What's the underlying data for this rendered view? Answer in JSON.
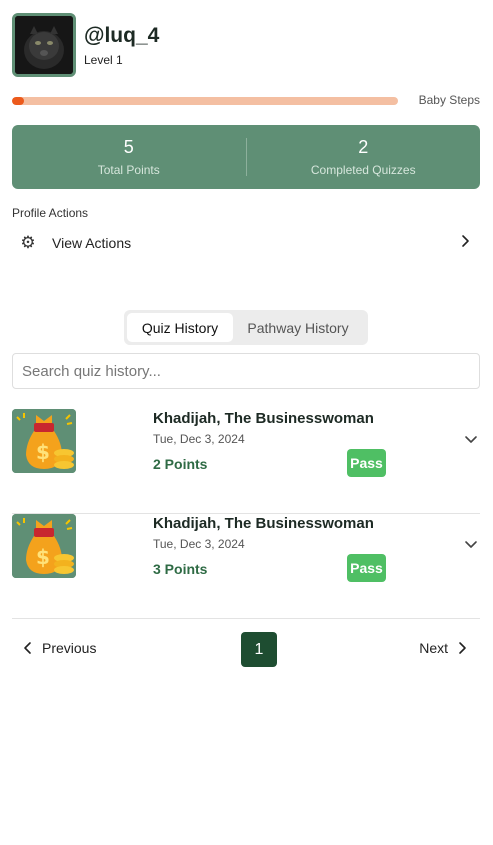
{
  "profile": {
    "username": "@luq_4",
    "level": "Level 1",
    "progress_fraction": 0.03,
    "progress_label": "Baby Steps"
  },
  "stats": [
    {
      "value": "5",
      "label": "Total Points"
    },
    {
      "value": "2",
      "label": "Completed Quizzes"
    }
  ],
  "profile_actions": {
    "title": "Profile Actions",
    "view_actions_label": "View Actions",
    "icon": "gear-icon"
  },
  "tabs": [
    {
      "label": "Quiz History",
      "active": true
    },
    {
      "label": "Pathway History",
      "active": false
    }
  ],
  "search": {
    "placeholder": "Search quiz history...",
    "value": ""
  },
  "quiz_history": [
    {
      "title": "Khadijah, The Businesswoman",
      "date": "Tue, Dec 3, 2024",
      "points": "2 Points",
      "status": "Pass",
      "icon": "money-bag-icon"
    },
    {
      "title": "Khadijah, The Businesswoman",
      "date": "Tue, Dec 3, 2024",
      "points": "3 Points",
      "status": "Pass",
      "icon": "money-bag-icon"
    }
  ],
  "pagination": {
    "previous_label": "Previous",
    "next_label": "Next",
    "current_page": "1"
  },
  "colors": {
    "accent_green": "#5f8f75",
    "dark_green": "#1e4d31",
    "pass_green": "#4fbf64",
    "progress_orange": "#ec5a1c",
    "progress_track": "#f4bfa2"
  }
}
